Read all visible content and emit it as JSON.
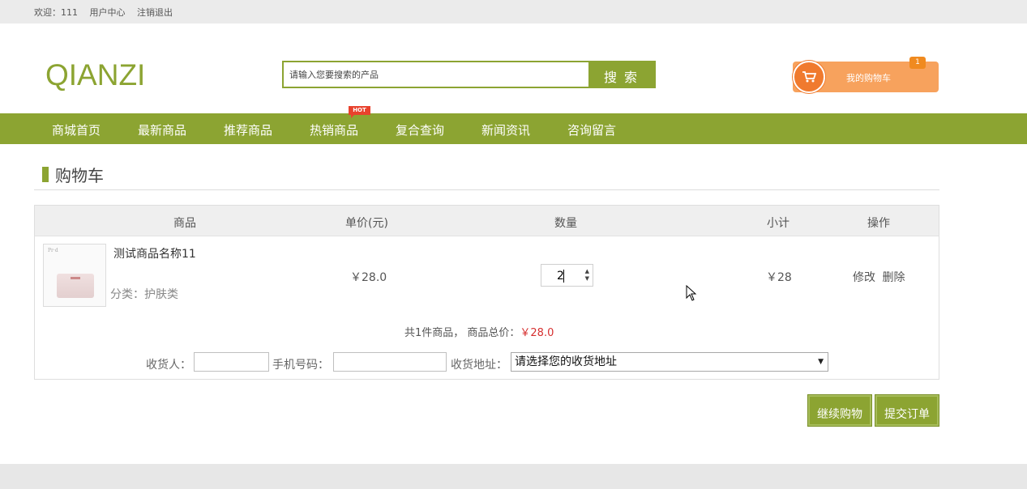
{
  "topbar": {
    "welcome": "欢迎：111",
    "user_center": "用户中心",
    "logout": "注销退出"
  },
  "header": {
    "logo": "QIANZI",
    "search_placeholder": "请输入您要搜索的产品",
    "search_button": "搜 索",
    "cart_label": "我的购物车",
    "cart_count": "1"
  },
  "nav": {
    "items": [
      "商城首页",
      "最新商品",
      "推荐商品",
      "热销商品",
      "复合查询",
      "新闻资讯",
      "咨询留言"
    ],
    "hot_badge": "HOT"
  },
  "page": {
    "title": "购物车"
  },
  "table": {
    "headers": [
      "商品",
      "单价(元)",
      "数量",
      "小计",
      "操作"
    ],
    "rows": [
      {
        "name": "测试商品名称11",
        "category": "分类：护肤类",
        "price": "￥28.0",
        "quantity": "2",
        "subtotal": "￥28",
        "edit": "修改",
        "delete": "删除"
      }
    ]
  },
  "summary": {
    "text": "共1件商品， 商品总价：",
    "total": "￥28.0"
  },
  "form": {
    "receiver_label": "收货人：",
    "phone_label": "手机号码：",
    "address_label": "收货地址：",
    "address_selected": "请选择您的收货地址"
  },
  "actions": {
    "continue": "继续购物",
    "submit": "提交订单"
  },
  "colors": {
    "brand_green": "#8ca432",
    "cart_orange": "#f7a25d",
    "price_red": "#d62f2f"
  }
}
